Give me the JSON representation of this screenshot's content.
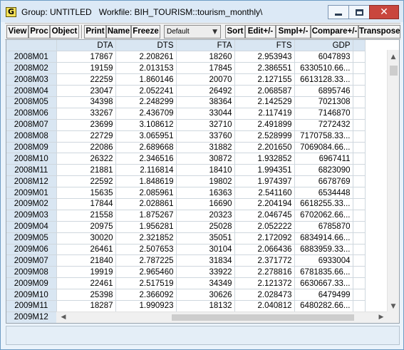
{
  "window": {
    "app_icon_letter": "G",
    "group_label": "Group: UNTITLED",
    "workfile_label": "Workfile: BIH_TOURISM::tourism_monthly\\",
    "controls": {
      "minimize": "minimize",
      "maximize": "maximize",
      "close": "✕"
    }
  },
  "toolbar": {
    "view": "View",
    "proc": "Proc",
    "object": "Object",
    "print": "Print",
    "name": "Name",
    "freeze": "Freeze",
    "format_select": "Default",
    "sort": "Sort",
    "edit": "Edit+/-",
    "smpl": "Smpl+/-",
    "compare": "Compare+/-",
    "transpose": "Transpose"
  },
  "grid": {
    "columns": [
      "DTA",
      "DTS",
      "FTA",
      "FTS",
      "GDP"
    ],
    "rows": [
      [
        "2008M01",
        "17867",
        "2.208261",
        "18260",
        "2.953943",
        "6047893"
      ],
      [
        "2008M02",
        "19159",
        "2.013153",
        "17845",
        "2.386551",
        "6330510.66..."
      ],
      [
        "2008M03",
        "22259",
        "1.860146",
        "20070",
        "2.127155",
        "6613128.33..."
      ],
      [
        "2008M04",
        "23047",
        "2.052241",
        "26492",
        "2.068587",
        "6895746"
      ],
      [
        "2008M05",
        "34398",
        "2.248299",
        "38364",
        "2.142529",
        "7021308"
      ],
      [
        "2008M06",
        "33267",
        "2.436709",
        "33044",
        "2.117419",
        "7146870"
      ],
      [
        "2008M07",
        "23699",
        "3.108612",
        "32710",
        "2.491899",
        "7272432"
      ],
      [
        "2008M08",
        "22729",
        "3.065951",
        "33760",
        "2.528999",
        "7170758.33..."
      ],
      [
        "2008M09",
        "22086",
        "2.689668",
        "31882",
        "2.201650",
        "7069084.66..."
      ],
      [
        "2008M10",
        "26322",
        "2.346516",
        "30872",
        "1.932852",
        "6967411"
      ],
      [
        "2008M11",
        "21881",
        "2.116814",
        "18410",
        "1.994351",
        "6823090"
      ],
      [
        "2008M12",
        "22592",
        "1.848619",
        "19802",
        "1.974397",
        "6678769"
      ],
      [
        "2009M01",
        "15635",
        "2.085961",
        "16363",
        "2.541160",
        "6534448"
      ],
      [
        "2009M02",
        "17844",
        "2.028861",
        "16690",
        "2.204194",
        "6618255.33..."
      ],
      [
        "2009M03",
        "21558",
        "1.875267",
        "20323",
        "2.046745",
        "6702062.66..."
      ],
      [
        "2009M04",
        "20975",
        "1.956281",
        "25028",
        "2.052222",
        "6785870"
      ],
      [
        "2009M05",
        "30020",
        "2.321852",
        "35051",
        "2.172092",
        "6834914.66..."
      ],
      [
        "2009M06",
        "26461",
        "2.507653",
        "30104",
        "2.066436",
        "6883959.33..."
      ],
      [
        "2009M07",
        "21840",
        "2.787225",
        "31834",
        "2.371772",
        "6933004"
      ],
      [
        "2009M08",
        "19919",
        "2.965460",
        "33922",
        "2.278816",
        "6781835.66..."
      ],
      [
        "2009M09",
        "22461",
        "2.517519",
        "34349",
        "2.121372",
        "6630667.33..."
      ],
      [
        "2009M10",
        "25398",
        "2.366092",
        "30626",
        "2.028473",
        "6479499"
      ],
      [
        "2009M11",
        "18287",
        "1.990923",
        "18132",
        "2.040812",
        "6480282.66..."
      ],
      [
        "2009M12",
        "",
        "",
        "",
        "",
        ""
      ]
    ]
  },
  "scrollbars": {
    "up_arrow": "▲",
    "down_arrow": "▼",
    "left_arrow": "◀",
    "right_arrow": "▶"
  }
}
